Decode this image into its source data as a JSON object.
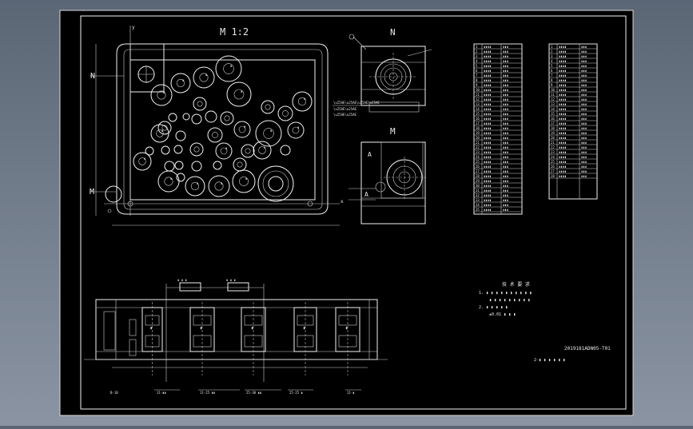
{
  "drawing": {
    "view_scale_label": "M 1:2",
    "view_n_label": "N",
    "view_m_label": "M",
    "section_n_label": "N",
    "section_m_label": "M",
    "section_a_label": "A",
    "drawing_number": "2019181ADN05-T01",
    "drawing_title": "2-▮ ▮ ▮ ▮ ▮ ▮",
    "notes_title": "技 术 要 求",
    "notes": [
      "1. ▮ ▮ ▮ ▮ ▮ ▮ ▮ ▮ ▮ ▮",
      "▮ ▮ ▮ ▮ ▮ ▮ ▮ ▮ ▮",
      "2.  ▮ ▮ ▮ ▮ ▮",
      "±0.01 ▮ ▮ ▮"
    ],
    "dim_labels": [
      "▮ ▮ ▮",
      "▮ ▮ ▮"
    ],
    "bottom_labels": [
      "B-10",
      "11-▮▮",
      "11-25 ▮▮",
      "25-30 ▮▮",
      "25-25 ▮",
      "11-▮"
    ]
  },
  "table_left": {
    "header": [
      "序号",
      "坐标"
    ],
    "rows": 35
  },
  "table_right": {
    "header": [
      "序号",
      "坐标"
    ],
    "rows": 28
  },
  "colors": {
    "frame_bg": "#000000",
    "line": "#f2f2f2",
    "viewport_bg": "#6f7a88"
  }
}
